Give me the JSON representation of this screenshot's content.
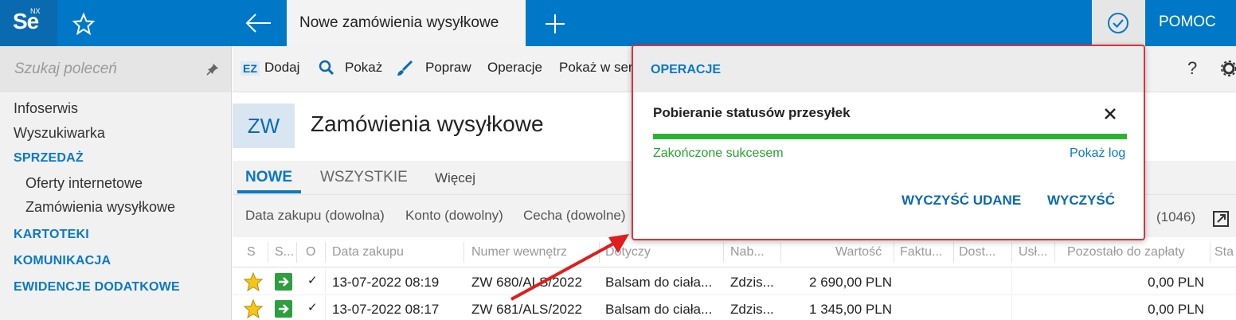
{
  "topbar": {
    "logo_main": "Se",
    "logo_super": "NX",
    "active_tab": "Nowe zamówienia wysyłkowe",
    "help_label": "POMOC",
    "icons": [
      "star-outline-icon",
      "back-arrow-icon",
      "plus-icon",
      "check-circle-icon"
    ]
  },
  "sidebar": {
    "search_placeholder": "Szukaj poleceń",
    "items": [
      {
        "label": "Infoserwis"
      },
      {
        "label": "Wyszukiwarka"
      },
      {
        "label": "SPRZEDAŻ"
      },
      {
        "label": "Oferty internetowe"
      },
      {
        "label": "Zamówienia wysyłkowe"
      },
      {
        "label": "KARTOTEKI"
      },
      {
        "label": "KOMUNIKACJA"
      },
      {
        "label": "EWIDENCJE DODATKOWE"
      }
    ]
  },
  "toolbar": {
    "ez_label": "EZ",
    "add_label": "Dodaj",
    "show_label": "Pokaż",
    "edit_label": "Popraw",
    "operations_label": "Operacje",
    "show_in_label": "Pokaż w ser",
    "help_mark": "?"
  },
  "header": {
    "code": "ZW",
    "title": "Zamówienia wysyłkowe"
  },
  "tabs": {
    "new": "NOWE",
    "all": "WSZYSTKIE",
    "more": "Więcej"
  },
  "filters": {
    "date": "Data zakupu (dowolna)",
    "account": "Konto (dowolny)",
    "feature": "Cecha (dowolne)",
    "count": "(1046)"
  },
  "table": {
    "columns": [
      "S",
      "S...",
      "O",
      "Data zakupu",
      "Numer wewnętrz",
      "Dotyczy",
      "Nab...",
      "Wartość",
      "Faktu...",
      "Dost...",
      "Usł...",
      "Pozostało do zapłaty",
      "Sta"
    ],
    "rows": [
      {
        "check": "✓",
        "date": "13-07-2022 08:19",
        "number": "ZW 680/ALS/2022",
        "concerns": "Balsam do ciała...",
        "buyer": "Zdzis...",
        "value": "2 690,00 PLN",
        "remaining": "0,00 PLN"
      },
      {
        "check": "✓",
        "date": "13-07-2022 08:17",
        "number": "ZW 681/ALS/2022",
        "concerns": "Balsam do ciała...",
        "buyer": "Zdzis...",
        "value": "1 345,00 PLN",
        "remaining": "0,00 PLN"
      }
    ]
  },
  "popup": {
    "title": "OPERACJE",
    "task": "Pobieranie statusów przesyłek",
    "progress_fraction": 1.0,
    "status": "Zakończone sukcesem",
    "log_link": "Pokaż log",
    "clear_successful": "WYCZYŚĆ UDANE",
    "clear": "WYCZYŚĆ"
  },
  "colors": {
    "brand_blue": "#0078c8",
    "accent_blue": "#0a79c5",
    "success_green": "#2ab432",
    "popup_border": "#d8343f"
  }
}
